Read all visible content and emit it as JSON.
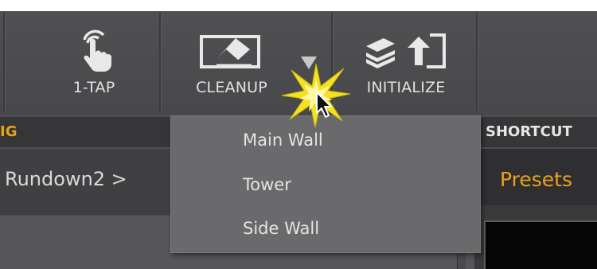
{
  "toolbar": {
    "buttons": [
      {
        "label": "1-TAP",
        "icon": "touch-icon"
      },
      {
        "label": "CLEANUP",
        "icon": "eraser-icon"
      },
      {
        "label": "INITIALIZE",
        "icon": "initialize-icon"
      }
    ],
    "dropdown_icon": "triangle-down-icon"
  },
  "section_headers": {
    "left": "IG",
    "right": "SHORTCUT"
  },
  "breadcrumb": {
    "text": "Rundown2 >"
  },
  "right_tab": {
    "label": "Presets"
  },
  "menu": {
    "items": [
      {
        "label": "Main Wall"
      },
      {
        "label": "Tower"
      },
      {
        "label": "Side Wall"
      }
    ]
  },
  "colors": {
    "accent": "#eba01c",
    "toolbar_bg": "#4f4f51",
    "menu_bg": "#6a6a6d",
    "burst": "#f5e021"
  }
}
